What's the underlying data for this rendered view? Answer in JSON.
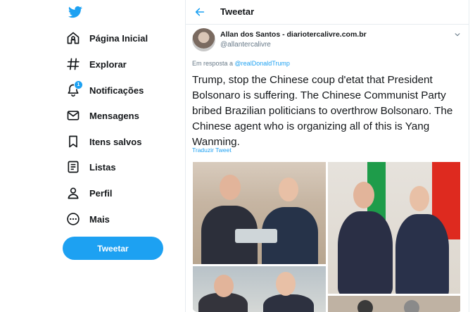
{
  "sidebar": {
    "logo_icon": "bird-icon",
    "items": [
      {
        "label": "Página Inicial",
        "icon": "home-icon"
      },
      {
        "label": "Explorar",
        "icon": "hashtag-icon"
      },
      {
        "label": "Notificações",
        "icon": "bell-icon",
        "badge": "1"
      },
      {
        "label": "Mensagens",
        "icon": "envelope-icon"
      },
      {
        "label": "Itens salvos",
        "icon": "bookmark-icon"
      },
      {
        "label": "Listas",
        "icon": "list-icon"
      },
      {
        "label": "Perfil",
        "icon": "person-icon"
      },
      {
        "label": "Mais",
        "icon": "more-circle-icon"
      }
    ],
    "tweet_button": "Tweetar"
  },
  "header": {
    "title": "Tweetar"
  },
  "tweet": {
    "author_name": "Allan dos Santos - diariotercalivre.com.br",
    "author_handle": "@allantercalivre",
    "reply_prefix": "Em resposta a",
    "reply_to": "@realDonaldTrump",
    "text": "Trump, stop the Chinese coup d'etat that President Bolsonaro is suffering.  The Chinese Communist Party bribed Brazilian politicians to overthrow Bolsonaro. The Chinese agent who is organizing all of this is Yang Wanming.",
    "translate_link": "Traduzir Tweet"
  },
  "colors": {
    "accent": "#1da1f2",
    "text": "#14171a",
    "muted": "#657786"
  }
}
